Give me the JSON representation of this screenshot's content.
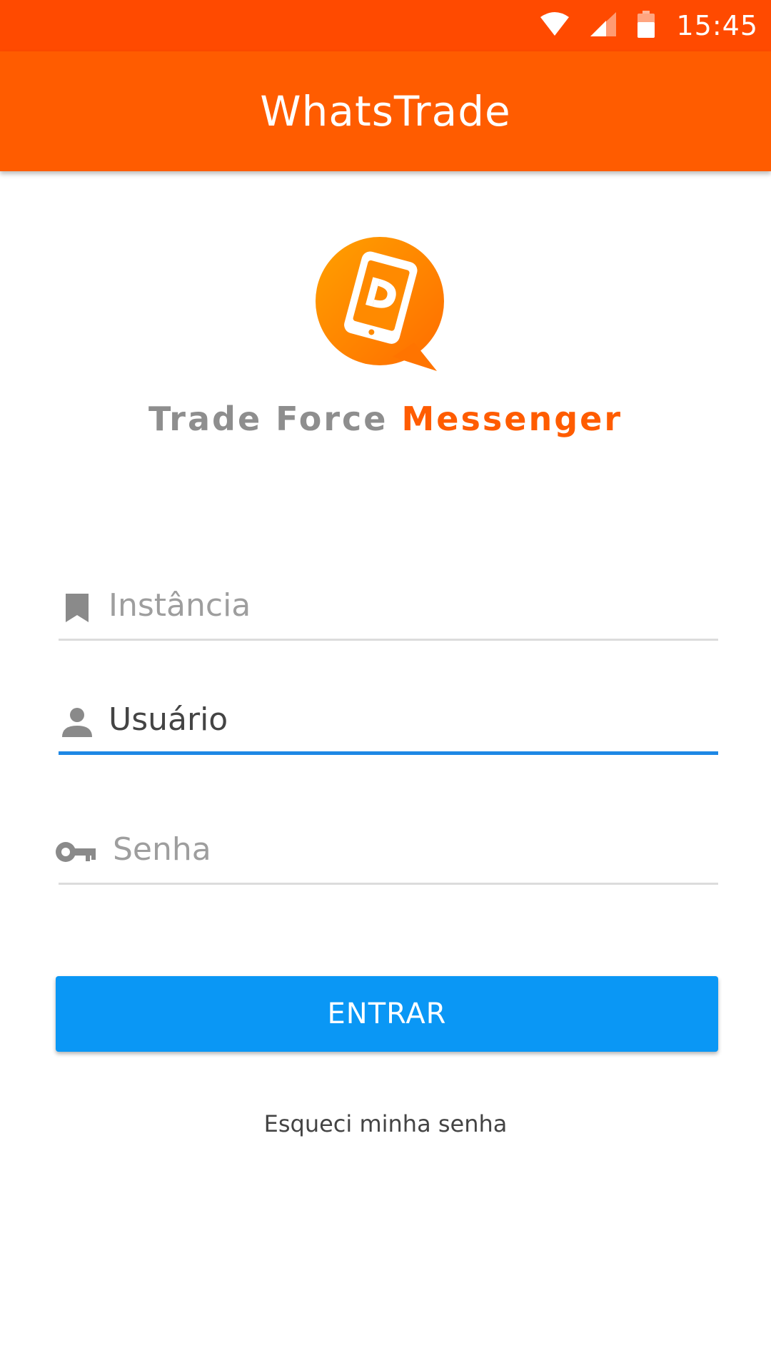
{
  "status_bar": {
    "time": "15:45",
    "icons": [
      "wifi-icon",
      "cell-signal-icon",
      "battery-icon"
    ],
    "background": "#ff4a00"
  },
  "app_bar": {
    "title": "WhatsTrade",
    "background": "#ff5c00"
  },
  "logo": {
    "brand_part1": "Trade Force",
    "brand_part2": "Messenger",
    "colors": {
      "grey": "#8e8e8e",
      "orange": "#ff5c00"
    }
  },
  "form": {
    "instance": {
      "placeholder": "Instância",
      "value": "",
      "icon": "bookmark-icon"
    },
    "user": {
      "placeholder": "Usuário",
      "value": "",
      "icon": "person-icon",
      "focused": true
    },
    "password": {
      "placeholder": "Senha",
      "value": "",
      "icon": "key-icon"
    },
    "submit_label": "ENTRAR",
    "forgot_label": "Esqueci minha senha"
  },
  "colors": {
    "accent": "#0a97f5",
    "focus_underline": "#1e88e5"
  }
}
